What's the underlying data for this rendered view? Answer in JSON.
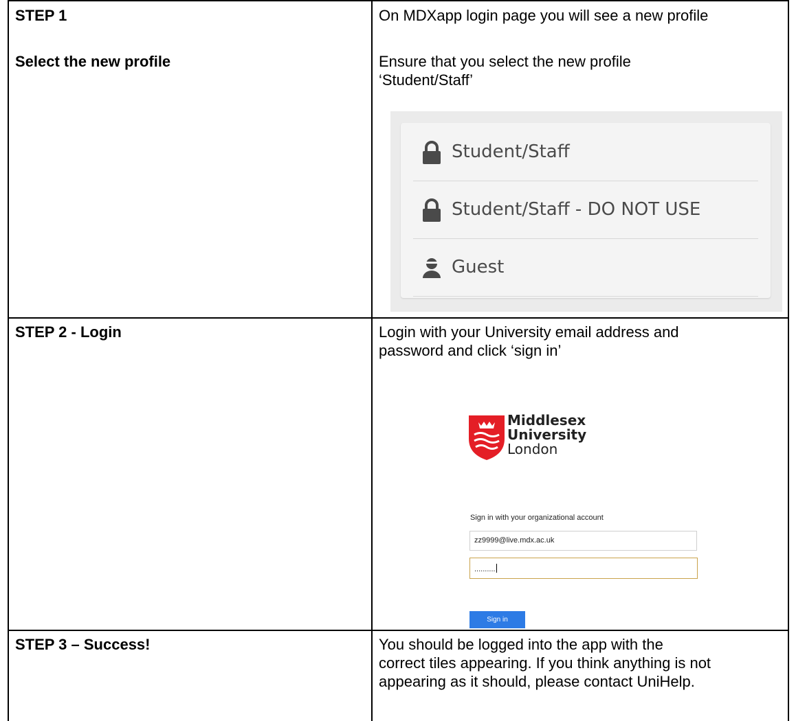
{
  "steps": [
    {
      "heading": "STEP 1",
      "subheading": "Select the new profile",
      "instruction": "On MDXapp login page you will see a new profile",
      "detail_line1": "Ensure that you select the new profile",
      "detail_line2": "‘Student/Staff’"
    },
    {
      "heading": "STEP 2 - Login",
      "instruction_line1": "Login with your University email address and",
      "instruction_line2": "password and click ‘sign in’"
    },
    {
      "heading": "STEP 3 – Success!",
      "instruction_line1": "You should be logged into the app with the",
      "instruction_line2": "correct tiles appearing. If you think anything is not",
      "instruction_line3": "appearing as it should, please contact UniHelp."
    }
  ],
  "profiles": {
    "items": [
      {
        "label": "Student/Staff",
        "icon": "lock-icon"
      },
      {
        "label": "Student/Staff - DO NOT USE",
        "icon": "lock-icon"
      },
      {
        "label": "Guest",
        "icon": "person-icon"
      }
    ]
  },
  "login": {
    "logo": {
      "line1": "Middlesex",
      "line2": "University",
      "line3": "London",
      "shield_color": "#e41e26"
    },
    "title": "Sign in with your organizational account",
    "email_value": "zz9999@live.mdx.ac.uk",
    "password_mask": "..........",
    "signin_label": "Sign in",
    "button_color": "#2d7be5"
  }
}
